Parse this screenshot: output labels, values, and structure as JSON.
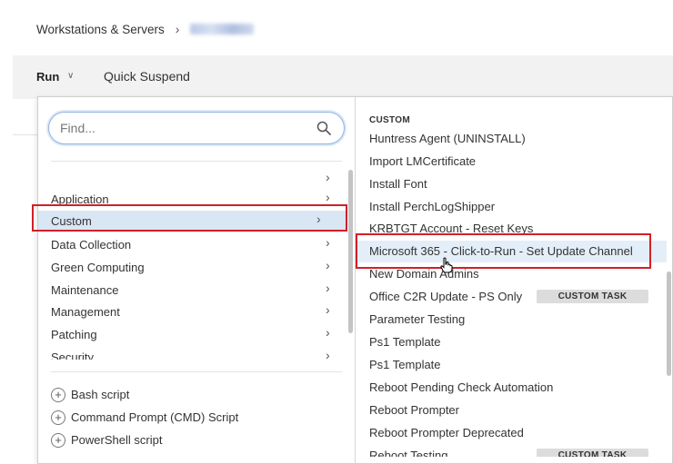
{
  "breadcrumb": {
    "root": "Workstations & Servers"
  },
  "toolbar": {
    "run_label": "Run",
    "quick_suspend_label": "Quick Suspend"
  },
  "search": {
    "placeholder": "Find...",
    "value": ""
  },
  "categories": [
    {
      "label": "",
      "selected": false
    },
    {
      "label": "Application",
      "selected": false
    },
    {
      "label": "Custom",
      "selected": true
    },
    {
      "label": "Data Collection",
      "selected": false
    },
    {
      "label": "Green Computing",
      "selected": false
    },
    {
      "label": "Maintenance",
      "selected": false
    },
    {
      "label": "Management",
      "selected": false
    },
    {
      "label": "Patching",
      "selected": false
    },
    {
      "label": "Security",
      "selected": false
    }
  ],
  "add_scripts": [
    {
      "label": "Bash script"
    },
    {
      "label": "Command Prompt (CMD) Script"
    },
    {
      "label": "PowerShell script"
    }
  ],
  "scripts_panel": {
    "header": "CUSTOM",
    "items": [
      {
        "label": "Huntress Agent (UNINSTALL)"
      },
      {
        "label": "Import LMCertificate"
      },
      {
        "label": "Install Font"
      },
      {
        "label": "Install PerchLogShipper"
      },
      {
        "label": "KRBTGT Account - Reset Keys"
      },
      {
        "label": "Microsoft 365 - Click-to-Run - Set Update Channel",
        "hovered": true
      },
      {
        "label": "New Domain Admins"
      },
      {
        "label": "Office C2R Update - PS Only",
        "tag": "CUSTOM TASK"
      },
      {
        "label": "Parameter Testing"
      },
      {
        "label": "Ps1 Template"
      },
      {
        "label": "Ps1 Template"
      },
      {
        "label": "Reboot Pending Check Automation"
      },
      {
        "label": "Reboot Prompter"
      },
      {
        "label": "Reboot Prompter Deprecated"
      },
      {
        "label": "Reboot Testing",
        "tag": "CUSTOM TASK"
      }
    ]
  },
  "colors": {
    "highlight_border": "#d0202a",
    "selected_bg": "#d9e6f4",
    "toolbar_bg": "#f2f2f2",
    "search_focus": "#8fb4e0"
  }
}
